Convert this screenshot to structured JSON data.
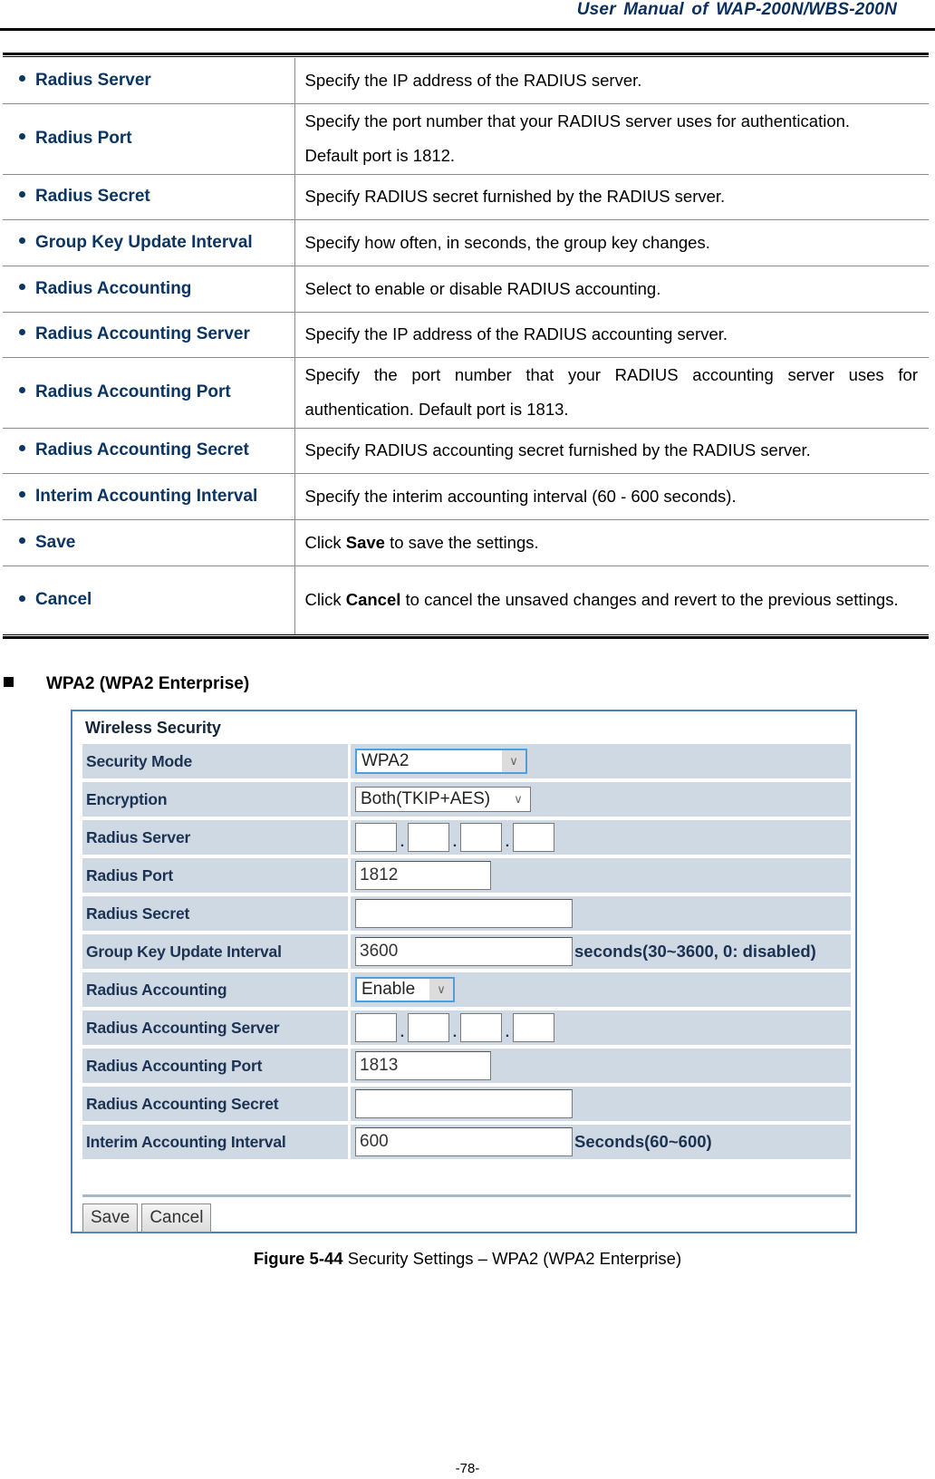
{
  "header": {
    "title": "User  Manual  of  WAP-200N/WBS-200N"
  },
  "params": [
    {
      "name": "Radius Server",
      "desc": [
        "Specify the IP address of the RADIUS server."
      ]
    },
    {
      "name": "Radius Port",
      "desc": [
        "Specify the port number that your RADIUS server uses for authentication.",
        "Default port is 1812."
      ]
    },
    {
      "name": "Radius Secret",
      "desc": [
        "Specify RADIUS secret furnished by the RADIUS server."
      ]
    },
    {
      "name": "Group Key Update Interval",
      "desc": [
        "Specify how often, in seconds, the group key changes."
      ]
    },
    {
      "name": "Radius Accounting",
      "desc": [
        "Select to enable or disable RADIUS accounting."
      ]
    },
    {
      "name": "Radius Accounting Server",
      "desc": [
        "Specify the IP address of the RADIUS accounting server."
      ]
    },
    {
      "name": "Radius Accounting Port",
      "desc": [
        "Specify the port number that your RADIUS accounting server uses for authentication. Default port is 1813."
      ]
    },
    {
      "name": "Radius Accounting Secret",
      "desc": [
        "Specify RADIUS accounting secret furnished by the RADIUS server."
      ]
    },
    {
      "name": "Interim Accounting Interval",
      "desc": [
        "Specify the interim accounting interval (60 - 600 seconds)."
      ]
    },
    {
      "name": "Save",
      "desc_prefix": "Click ",
      "desc_bold": "Save",
      "desc_suffix": " to save the settings."
    },
    {
      "name": "Cancel",
      "desc_prefix": "Click ",
      "desc_bold": "Cancel",
      "desc_suffix": " to cancel the unsaved changes and revert to the previous settings."
    }
  ],
  "section": {
    "heading": "WPA2 (WPA2 Enterprise)"
  },
  "figure": {
    "title": "Wireless Security",
    "rows": {
      "security_mode": {
        "label": "Security Mode",
        "value": "WPA2"
      },
      "encryption": {
        "label": "Encryption",
        "value": "Both(TKIP+AES)"
      },
      "radius_server": {
        "label": "Radius Server",
        "octets": [
          "",
          "",
          "",
          ""
        ]
      },
      "radius_port": {
        "label": "Radius Port",
        "value": "1812"
      },
      "radius_secret": {
        "label": "Radius Secret",
        "value": ""
      },
      "group_key": {
        "label": "Group Key Update Interval",
        "value": "3600",
        "unit": "seconds(30~3600, 0: disabled)"
      },
      "radius_accounting": {
        "label": "Radius Accounting",
        "value": "Enable"
      },
      "acct_server": {
        "label": "Radius Accounting Server",
        "octets": [
          "",
          "",
          "",
          ""
        ]
      },
      "acct_port": {
        "label": "Radius Accounting Port",
        "value": "1813"
      },
      "acct_secret": {
        "label": "Radius Accounting Secret",
        "value": ""
      },
      "interim": {
        "label": "Interim Accounting Interval",
        "value": "600",
        "unit": "Seconds(60~600)"
      }
    },
    "buttons": {
      "save": "Save",
      "cancel": "Cancel"
    }
  },
  "caption": {
    "number": "Figure 5-44",
    "text": " Security Settings – WPA2 (WPA2 Enterprise)"
  },
  "footer": {
    "page_number": "-78-"
  }
}
